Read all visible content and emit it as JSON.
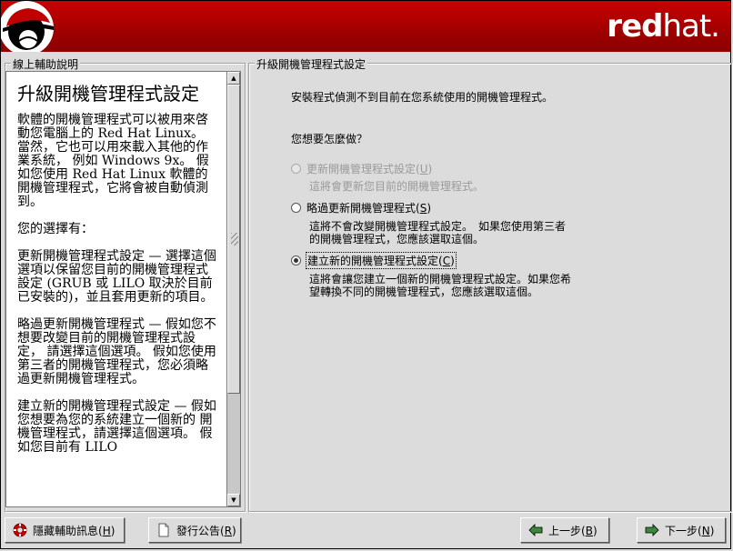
{
  "banner": {
    "brand_bold": "red",
    "brand_thin": "hat."
  },
  "help": {
    "group_title": "線上輔助說明",
    "title": "升級開機管理程式設定",
    "paragraphs": [
      "軟體的開機管理程式可以被用來啓動您電腦上的 Red Hat Linux。 當然，它也可以用來載入其他的作業系統， 例如 Windows 9x。 假如您使用 Red Hat Linux 軟體的開機管理程式，它將會被自動偵測到。",
      "您的選擇有：",
      "更新開機管理程式設定 — 選擇這個選項以保留您目前的開機管理程式設定 (GRUB 或 LILO 取決於目前已安裝的)，並且套用更新的項目。",
      "略過更新開機管理程式 — 假如您不想要改變目前的開機管理程式設定， 請選擇這個選項。 假如您使用第三者的開機管理程式，您必須略過更新開機管理程式。",
      "建立新的開機管理程式設定 — 假如您想要為您的系統建立一個新的 開機管理程式，請選擇這個選項。 假如您目前有 LILO"
    ]
  },
  "main": {
    "group_title": "升級開機管理程式設定",
    "intro": "安裝程式偵測不到目前在您系統使用的開機管理程式。",
    "question": "您想要怎麼做？",
    "options": [
      {
        "label": "更新開機管理程式設定",
        "accel": "U",
        "description": "這將會更新您目前的開機管理程式。",
        "disabled": true,
        "checked": false
      },
      {
        "label": "略過更新開機管理程式",
        "accel": "S",
        "description": "這將不會改變開機管理程式設定。　如果您使用第三者的開機管理程式，您應該選取這個。",
        "disabled": false,
        "checked": false
      },
      {
        "label": "建立新的開機管理程式設定",
        "accel": "C",
        "description": "這將會讓您建立一個新的開機管理程式設定。如果您希望轉換不同的開機管理程式，您應該選取這個。",
        "disabled": false,
        "checked": true
      }
    ]
  },
  "buttons": {
    "hide_help": {
      "label": "隱藏輔助訊息",
      "accel": "H"
    },
    "release_notes": {
      "label": "發行公告",
      "accel": "R"
    },
    "back": {
      "label": "上一步",
      "accel": "B"
    },
    "next": {
      "label": "下一步",
      "accel": "N"
    }
  },
  "colors": {
    "banner_red": "#b00000",
    "background": "#dcdcdc"
  }
}
